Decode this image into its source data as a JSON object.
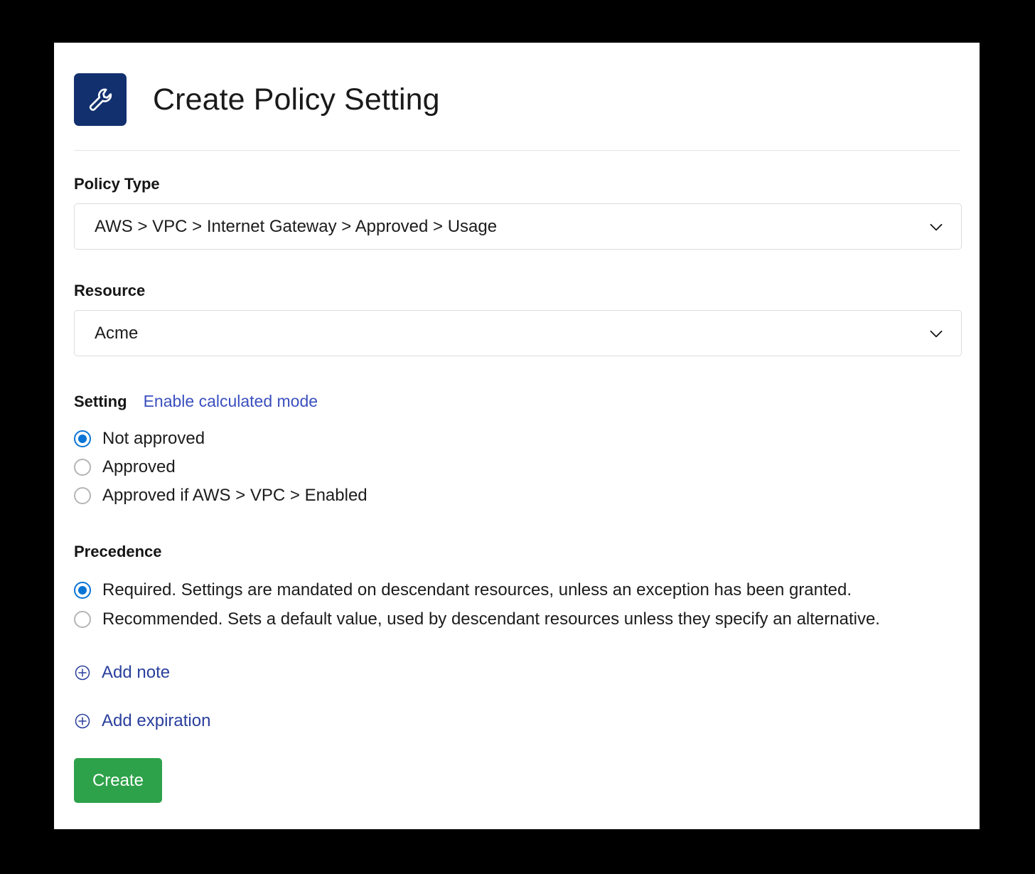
{
  "header": {
    "title": "Create Policy Setting",
    "icon": "wrench-icon",
    "icon_background": "#12306e"
  },
  "form": {
    "policy_type": {
      "label": "Policy Type",
      "value": "AWS > VPC > Internet Gateway > Approved > Usage",
      "chevron": "chevron-down-icon"
    },
    "resource": {
      "label": "Resource",
      "value": "Acme",
      "chevron": "chevron-down-icon"
    },
    "setting": {
      "label": "Setting",
      "link": "Enable calculated mode",
      "link_color": "#3a4fbe",
      "options": [
        {
          "label": "Not approved",
          "selected": true
        },
        {
          "label": "Approved",
          "selected": false
        },
        {
          "label": "Approved if AWS > VPC > Enabled",
          "selected": false
        }
      ]
    },
    "precedence": {
      "label": "Precedence",
      "options": [
        {
          "label": "Required. Settings are mandated on descendant resources, unless an exception has been granted.",
          "selected": true
        },
        {
          "label": "Recommended. Sets a default value, used by descendant resources unless they specify an alternative.",
          "selected": false
        }
      ]
    },
    "add_links": [
      {
        "label": "Add note",
        "icon": "plus-circle-icon"
      },
      {
        "label": "Add expiration",
        "icon": "plus-circle-icon"
      }
    ],
    "submit": {
      "label": "Create",
      "color": "#2ea24a"
    }
  }
}
